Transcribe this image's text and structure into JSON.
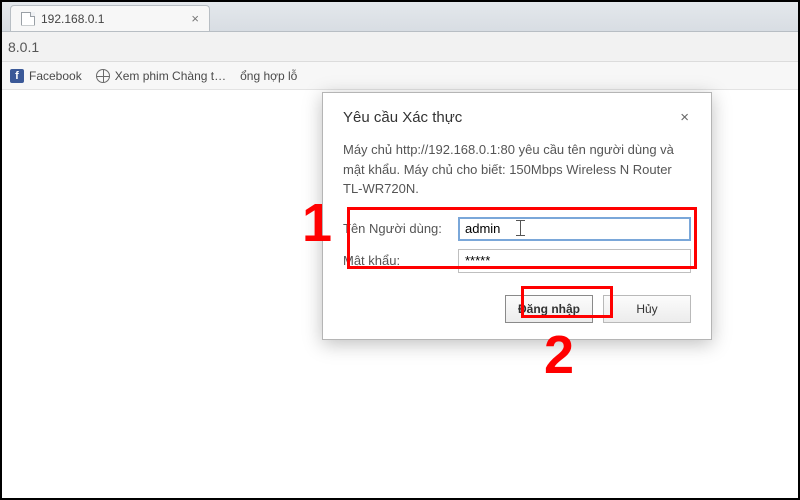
{
  "browser": {
    "tab_title": "192.168.0.1",
    "address": "8.0.1"
  },
  "bookmarks": {
    "facebook": "Facebook",
    "bm2": "Xem phim Chàng t…",
    "bm3": "ổng hợp lỗ"
  },
  "dialog": {
    "title": "Yêu cầu Xác thực",
    "message": "Máy chủ http://192.168.0.1:80 yêu cầu tên người dùng và mật khẩu. Máy chủ cho biết: 150Mbps Wireless N Router TL-WR720N.",
    "username_label": "Tên Người dùng:",
    "password_label": "Mật khẩu:",
    "username_value": "admin",
    "password_value": "*****",
    "login_btn": "Đăng nhập",
    "cancel_btn": "Hủy"
  },
  "annotations": {
    "label1": "1",
    "label2": "2"
  }
}
